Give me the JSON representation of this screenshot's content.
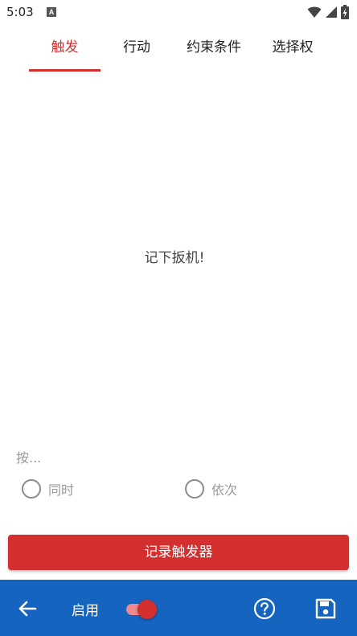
{
  "status_bar": {
    "time": "5:03",
    "app_icon_glyph": "A",
    "icons": [
      "wifi-icon",
      "signal-icon",
      "battery-charging-icon"
    ]
  },
  "tabs": [
    {
      "label": "触发",
      "active": true
    },
    {
      "label": "行动",
      "active": false
    },
    {
      "label": "约束条件",
      "active": false
    },
    {
      "label": "选择权",
      "active": false
    }
  ],
  "main": {
    "empty_message": "记下扳机!",
    "hint": "按..."
  },
  "radio_options": [
    {
      "label": "同时",
      "checked": false
    },
    {
      "label": "依次",
      "checked": false
    }
  ],
  "record_button_label": "记录触发器",
  "bottom_bar": {
    "enable_label": "启用",
    "enable_toggle_on": true,
    "icons": [
      "back-arrow-icon",
      "help-icon",
      "save-icon"
    ]
  },
  "colors": {
    "accent": "#d32f2f",
    "bottom_bar": "#1565c0"
  }
}
